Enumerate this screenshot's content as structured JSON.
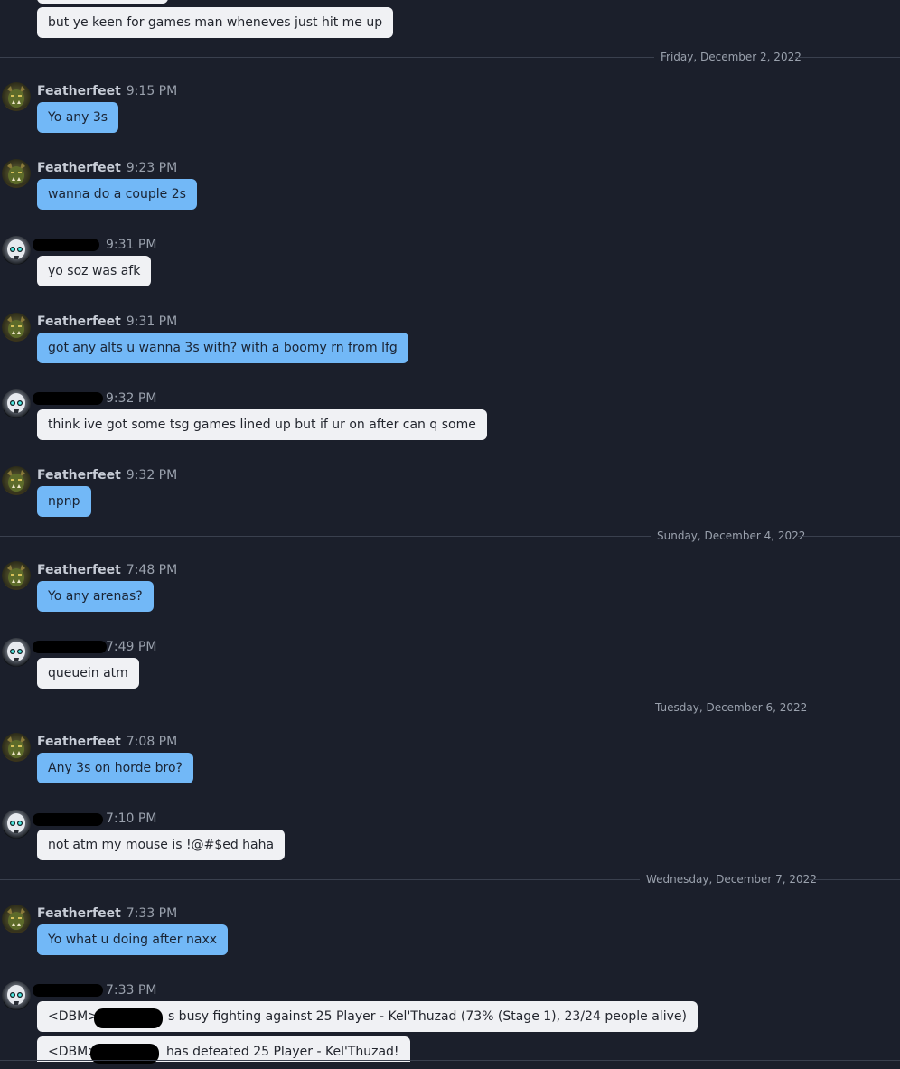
{
  "colors": {
    "background": "#1b1f2b",
    "outgoing_bubble": "#72b8f7",
    "incoming_bubble": "#f0f1f4",
    "divider": "#3a404e"
  },
  "conversation": {
    "top_message": "but ye keen for games man wheneves just hit me up",
    "dividers": {
      "d1": "Friday, December 2, 2022",
      "d2": "Sunday, December 4, 2022",
      "d3": "Tuesday, December 6, 2022",
      "d4": "Wednesday, December 7, 2022"
    },
    "messages": [
      {
        "sender": "Featherfeet",
        "time": "9:15 PM",
        "text": "Yo any 3s"
      },
      {
        "sender": "Featherfeet",
        "time": "9:23 PM",
        "text": "wanna do a couple 2s"
      },
      {
        "sender": "",
        "time": "9:31 PM",
        "text": "yo soz was afk"
      },
      {
        "sender": "Featherfeet",
        "time": "9:31 PM",
        "text": "got any alts u wanna 3s with? with a boomy rn from lfg"
      },
      {
        "sender": "",
        "time": "9:32 PM",
        "text": "think ive got some tsg games lined up but if ur on after can q some"
      },
      {
        "sender": "Featherfeet",
        "time": "9:32 PM",
        "text": "npnp"
      },
      {
        "sender": "Featherfeet",
        "time": "7:48 PM",
        "text": "Yo any arenas?"
      },
      {
        "sender": "",
        "time": "7:49 PM",
        "text": "queuein atm"
      },
      {
        "sender": "Featherfeet",
        "time": "7:08 PM",
        "text": "Any 3s on horde bro?"
      },
      {
        "sender": "",
        "time": "7:10 PM",
        "text": "not atm my mouse is !@#$ed haha"
      },
      {
        "sender": "Featherfeet",
        "time": "7:33 PM",
        "text": "Yo what u doing after naxx"
      },
      {
        "sender": "",
        "time": "7:33 PM",
        "text": ""
      }
    ],
    "dbm_1": {
      "prefix": "<DBM>",
      "suffix": "s busy fighting against 25 Player - Kel'Thuzad (73% (Stage 1), 23/24 people alive)"
    },
    "dbm_2": {
      "prefix": "<DBM>",
      "suffix": "has defeated 25 Player - Kel'Thuzad!"
    }
  },
  "icons": {
    "featherfeet_avatar": "orc-portrait-avatar",
    "contact_avatar": "skull-glowing-eyes-avatar"
  }
}
